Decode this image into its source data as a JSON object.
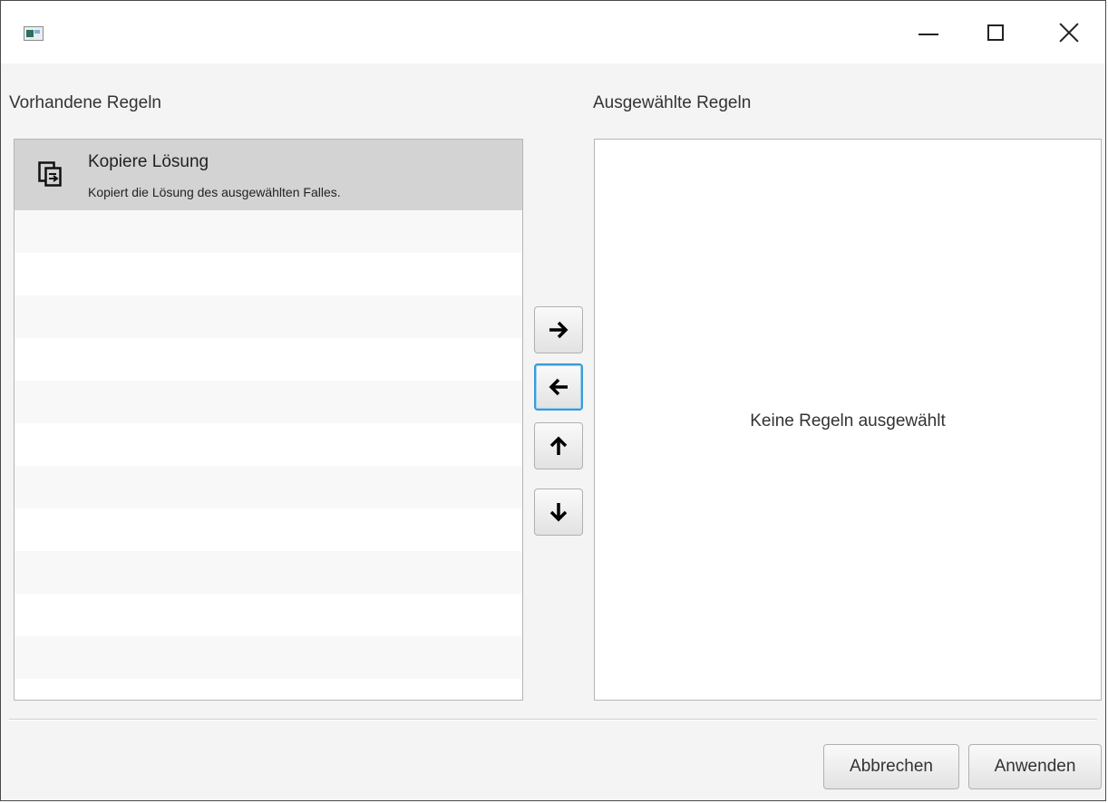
{
  "window": {
    "icon": "app-icon",
    "controls": {
      "minimize": "minimize-icon",
      "maximize": "maximize-icon",
      "close": "close-icon"
    }
  },
  "available": {
    "label": "Vorhandene Regeln",
    "items": [
      {
        "icon": "copy-solution-icon",
        "title": "Kopiere Lösung",
        "description": "Kopiert die Lösung des ausgewählten Falles.",
        "selected": true
      }
    ]
  },
  "selected": {
    "label": "Ausgewählte Regeln",
    "placeholder": "Keine Regeln ausgewählt",
    "items": []
  },
  "move_buttons": {
    "add": "arrow-right-icon",
    "remove": "arrow-left-icon",
    "up": "arrow-up-icon",
    "down": "arrow-down-icon",
    "focused": "remove"
  },
  "footer": {
    "cancel_label": "Abbrechen",
    "apply_label": "Anwenden"
  },
  "colors": {
    "selection": "#d3d3d3",
    "focus": "#3a9bd9",
    "border": "#b5b5b5"
  }
}
